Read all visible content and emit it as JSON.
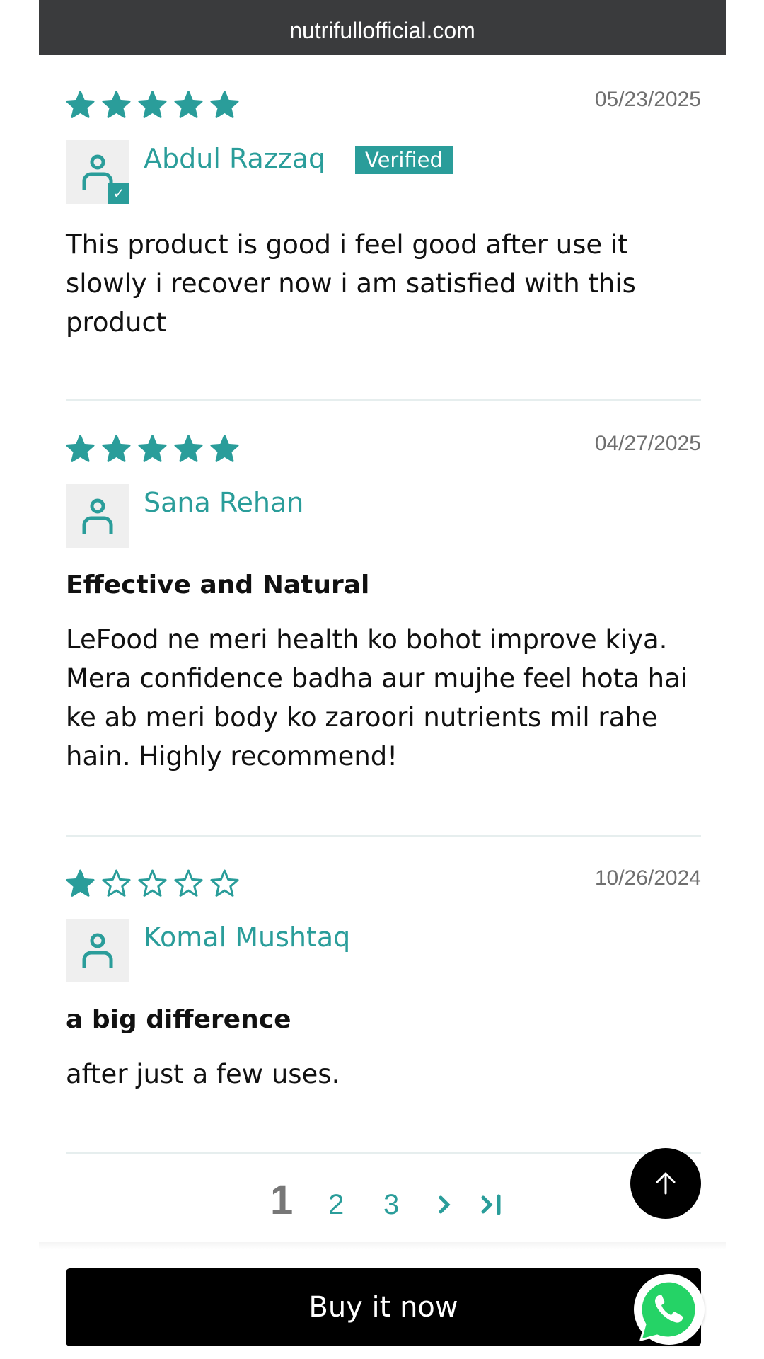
{
  "browser": {
    "url": "nutrifullofficial.com"
  },
  "reviews": [
    {
      "rating": 5,
      "date": "05/23/2025",
      "name": "Abdul Razzaq",
      "badge": "Verified",
      "title": "",
      "body": "This product is good i feel good after use it slowly i recover now i am satisfied with this product"
    },
    {
      "rating": 5,
      "date": "04/27/2025",
      "name": "Sana Rehan",
      "badge": "",
      "title": "Effective and Natural",
      "body": "LeFood ne meri health ko bohot improve kiya. Mera confidence badha aur mujhe feel hota hai ke ab meri body ko zaroori nutrients mil rahe hain. Highly recommend!"
    },
    {
      "rating": 1,
      "date": "10/26/2024",
      "name": "Komal Mushtaq",
      "badge": "",
      "title": "a big difference",
      "body": "after just a few uses."
    }
  ],
  "pagination": {
    "pages": [
      "1",
      "2",
      "3"
    ],
    "current": "1",
    "next_icon": "chevron-right-icon",
    "last_icon": "last-page-icon"
  },
  "actions": {
    "buy_label": "Buy it now"
  },
  "colors": {
    "accent": "#2a9d9a",
    "topbar": "#3a3b3d"
  }
}
